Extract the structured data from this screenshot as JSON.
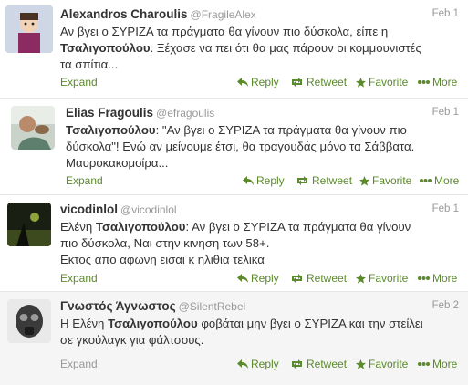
{
  "tweets": [
    {
      "name": "Alexandros Charoulis",
      "handle": "@FragileAlex",
      "date": "Feb 1",
      "lines": [
        [
          "Αν βγει ο ΣΥΡΙΖΑ τα πράγματα θα γίνουν πιο δύσκολα, είπε η"
        ],
        [
          "",
          "Τσαλιγοπούλου",
          ". Ξέχασε να πει ότι θα μας πάρουν οι κομμουνιστές"
        ],
        [
          "τα σπίτια..."
        ]
      ],
      "expand": "Expand",
      "reply": "Reply",
      "retweet": "Retweet",
      "favorite": "Favorite",
      "more": "More"
    },
    {
      "name": "Elias Fragoulis",
      "handle": "@efragoulis",
      "date": "Feb 1",
      "lines": [
        [
          "",
          "Τσαλιγοπούλου",
          ": \"Αν βγει ο ΣΥΡΙΖΑ τα πράγματα θα γίνουν πιο"
        ],
        [
          "δύσκολα\"! Ενώ αν μείνουμε έτσι, θα τραγουδάς μόνο τα Σάββατα."
        ],
        [
          "Μαυροκακομοίρα..."
        ]
      ],
      "expand": "Expand",
      "reply": "Reply",
      "retweet": "Retweet",
      "favorite": "Favorite",
      "more": "More"
    },
    {
      "name": "vicodinlol",
      "handle": "@vicodinlol",
      "date": "Feb 1",
      "lines": [
        [
          "Ελένη ",
          "Τσαλιγοπούλου",
          ": Αν βγει ο ΣΥΡΙΖΑ τα πράγματα θα γίνουν"
        ],
        [
          "πιο δύσκολα, Ναι στην κινηση των 58+."
        ],
        [
          "Εκτος απο αφωνη εισαι κ ηλιθια τελικα"
        ]
      ],
      "expand": "Expand",
      "reply": "Reply",
      "retweet": "Retweet",
      "favorite": "Favorite",
      "more": "More"
    },
    {
      "name": "Γνωστός Άγνωστος",
      "handle": "@SilentRebel",
      "date": "Feb 2",
      "lines": [
        [
          "Η Ελένη ",
          "Τσαλιγοπούλου",
          " φοβάται μην βγει ο ΣΥΡΙΖΑ και την στείλει"
        ],
        [
          "σε γκούλαγκ για φάλτσους."
        ]
      ],
      "expand": "Expand",
      "reply": "Reply",
      "retweet": "Retweet",
      "favorite": "Favorite",
      "more": "More"
    }
  ],
  "colors": {
    "link": "#5a8a2b",
    "text": "#333333",
    "muted": "#999999",
    "alt_bg": "#f5f5f5"
  }
}
